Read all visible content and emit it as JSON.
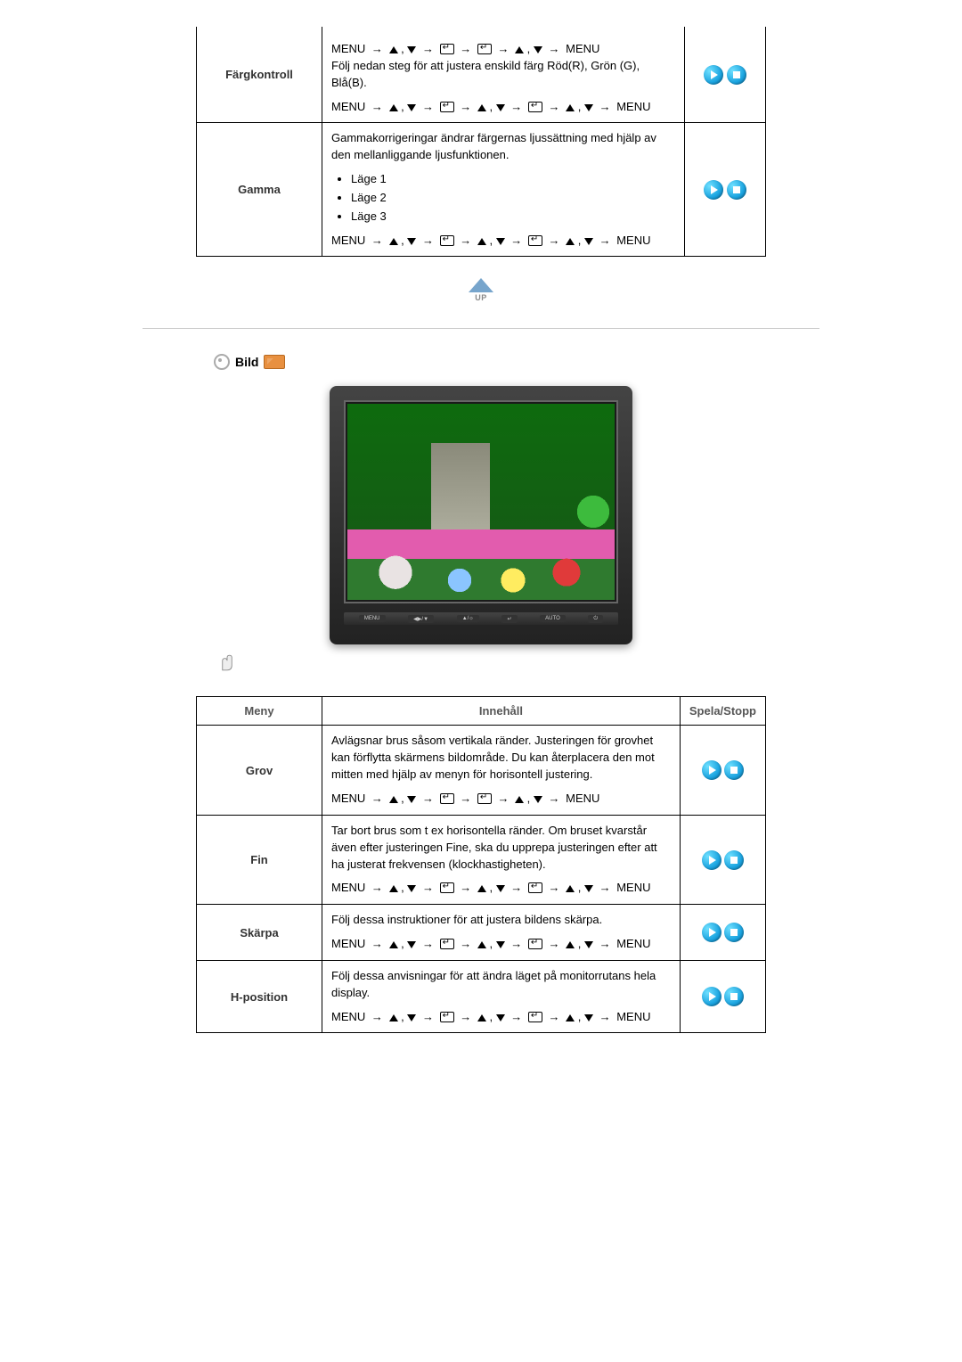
{
  "glyphs": {
    "menu": "MENU",
    "arrow": "→",
    "comma": ","
  },
  "top_table": {
    "rows": [
      {
        "name": "Färgkontroll",
        "seq_top": [
          "menu",
          "arrow",
          "up",
          "comma",
          "down",
          "arrow",
          "enter",
          "arrow",
          "enter",
          "arrow",
          "up",
          "comma",
          "down",
          "arrow",
          "menu"
        ],
        "desc": "Följ nedan steg för att justera enskild färg Röd(R), Grön (G), Blå(B).",
        "seq_bot": [
          "menu",
          "arrow",
          "up",
          "comma",
          "down",
          "arrow",
          "enter",
          "arrow",
          "up",
          "comma",
          "down",
          "arrow",
          "enter",
          "arrow",
          "up",
          "comma",
          "down",
          "arrow",
          "menu"
        ]
      },
      {
        "name": "Gamma",
        "desc": "Gammakorrigeringar ändrar färgernas ljussättning med hjälp av den mellanliggande ljusfunktionen.",
        "bullets": [
          "Läge 1",
          "Läge 2",
          "Läge 3"
        ],
        "seq_bot": [
          "menu",
          "arrow",
          "up",
          "comma",
          "down",
          "arrow",
          "enter",
          "arrow",
          "up",
          "comma",
          "down",
          "arrow",
          "enter",
          "arrow",
          "up",
          "comma",
          "down",
          "arrow",
          "menu"
        ]
      }
    ]
  },
  "up_label": "UP",
  "section": {
    "title": "Bild"
  },
  "btnbar": [
    "MENU",
    "◀▶/▼",
    "▲/☼",
    "↵",
    "AUTO",
    "⏻"
  ],
  "headers": {
    "meny": "Meny",
    "innehall": "Innehåll",
    "spela": "Spela/Stopp"
  },
  "bild_rows": [
    {
      "name": "Grov",
      "desc": "Avlägsnar brus såsom vertikala ränder. Justeringen för grovhet kan förflytta skärmens bildområde. Du kan återplacera den mot mitten med hjälp av menyn för horisontell justering.",
      "seq": [
        "menu",
        "arrow",
        "up",
        "comma",
        "down",
        "arrow",
        "enter",
        "arrow",
        "enter",
        "arrow",
        "up",
        "comma",
        "down",
        "arrow",
        "menu"
      ]
    },
    {
      "name": "Fin",
      "desc": "Tar bort brus som t ex horisontella ränder. Om bruset kvarstår även efter justeringen Fine, ska du upprepa justeringen efter att ha justerat frekvensen (klockhastigheten).",
      "seq": [
        "menu",
        "arrow",
        "up",
        "comma",
        "down",
        "arrow",
        "enter",
        "arrow",
        "up",
        "comma",
        "down",
        "arrow",
        "enter",
        "arrow",
        "up",
        "comma",
        "down",
        "arrow",
        "menu"
      ]
    },
    {
      "name": "Skärpa",
      "desc": "Följ dessa instruktioner för att justera bildens skärpa.",
      "seq": [
        "menu",
        "arrow",
        "up",
        "comma",
        "down",
        "arrow",
        "enter",
        "arrow",
        "up",
        "comma",
        "down",
        "arrow",
        "enter",
        "arrow",
        "up",
        "comma",
        "down",
        "arrow",
        "menu"
      ]
    },
    {
      "name": "H-position",
      "desc": "Följ dessa anvisningar för att ändra läget på monitorrutans hela display.",
      "seq": [
        "menu",
        "arrow",
        "up",
        "comma",
        "down",
        "arrow",
        "enter",
        "arrow",
        "up",
        "comma",
        "down",
        "arrow",
        "enter",
        "arrow",
        "up",
        "comma",
        "down",
        "arrow",
        "menu"
      ]
    }
  ]
}
